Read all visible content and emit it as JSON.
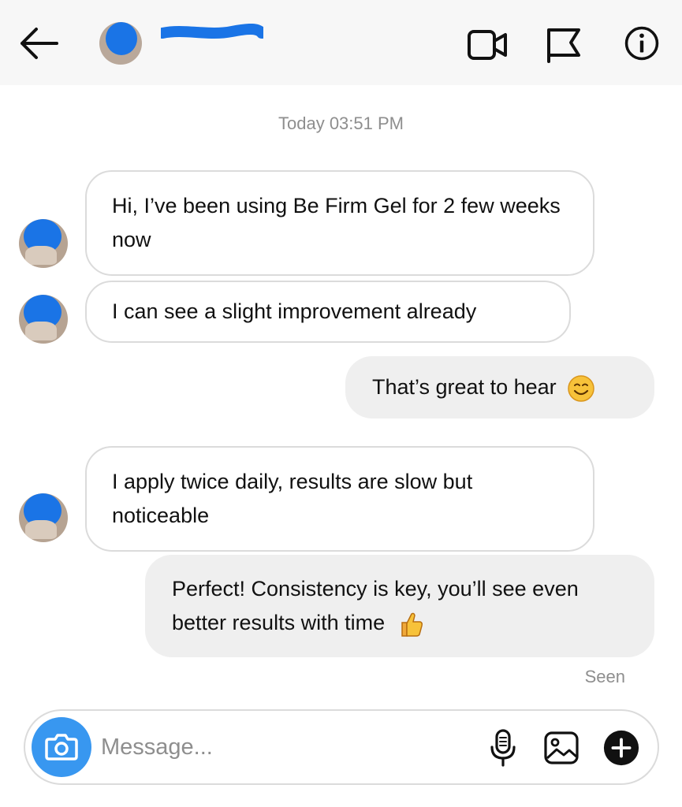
{
  "header": {
    "back_icon": "arrow-left-icon",
    "actions": [
      "video-call-icon",
      "flag-icon",
      "info-icon"
    ]
  },
  "thread": {
    "timestamp": "Today 03:51 PM",
    "messages": [
      {
        "direction": "incoming",
        "text": "Hi, I’ve been using Be Firm Gel for 2 few weeks now"
      },
      {
        "direction": "incoming",
        "text": "I can see a slight improvement already"
      },
      {
        "direction": "outgoing",
        "text": "That’s great to hear",
        "emoji": "smiling-face-icon"
      },
      {
        "direction": "incoming",
        "text": "I apply twice daily, results are slow but noticeable"
      },
      {
        "direction": "outgoing",
        "text": "Perfect! Consistency is key, you’ll see even better results with time",
        "emoji": "thumbs-up-icon"
      }
    ],
    "seen_label": "Seen"
  },
  "composer": {
    "placeholder": "Message...",
    "icons": [
      "camera-icon",
      "microphone-icon",
      "image-icon",
      "plus-icon"
    ]
  },
  "colors": {
    "header_bg": "#f7f7f7",
    "outgoing_bubble": "#efefef",
    "incoming_border": "#dbdbdb",
    "camera_button": "#3897f0",
    "redaction_blue": "#1a74e6",
    "muted_text": "#8e8e8e"
  }
}
